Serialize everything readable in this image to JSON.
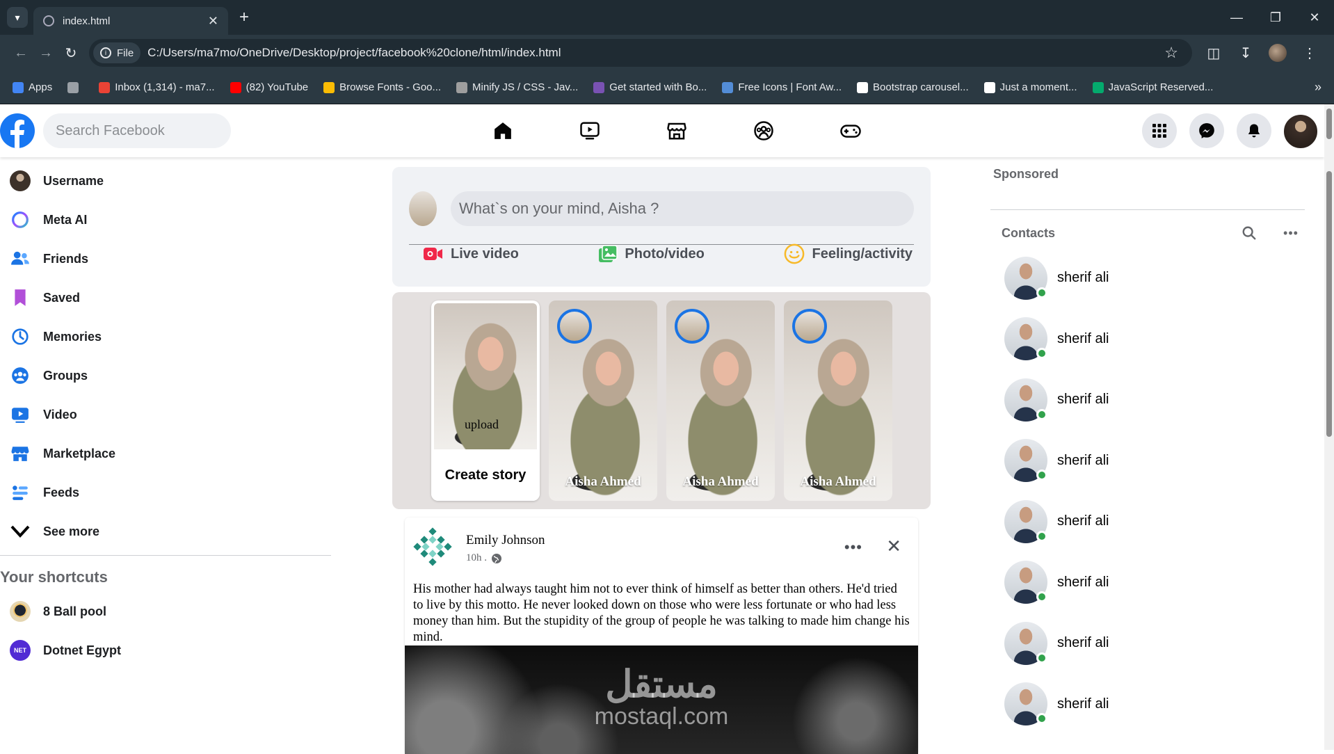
{
  "browser": {
    "tab_title": "index.html",
    "url": "C:/Users/ma7mo/OneDrive/Desktop/project/facebook%20clone/html/index.html",
    "file_chip": "File",
    "bookmarks": [
      {
        "label": "Apps",
        "color": "#4285f4"
      },
      {
        "label": "",
        "color": "#9aa0a6"
      },
      {
        "label": "Inbox (1,314) - ma7...",
        "color": "#ea4335"
      },
      {
        "label": "(82) YouTube",
        "color": "#ff0000"
      },
      {
        "label": "Browse Fonts - Goo...",
        "color": "#fbbc04"
      },
      {
        "label": "Minify JS / CSS - Jav...",
        "color": "#9e9e9e"
      },
      {
        "label": "Get started with Bo...",
        "color": "#7952b3"
      },
      {
        "label": "Free Icons | Font Aw...",
        "color": "#538dd7"
      },
      {
        "label": "Bootstrap carousel...",
        "color": "#ffffff"
      },
      {
        "label": "Just a moment...",
        "color": "#ffffff"
      },
      {
        "label": "JavaScript Reserved...",
        "color": "#04aa6d"
      }
    ]
  },
  "header": {
    "search_placeholder": "Search Facebook"
  },
  "sidebar": {
    "items": [
      {
        "label": "Username",
        "icon": "user-avatar"
      },
      {
        "label": "Meta AI",
        "icon": "meta-ai-icon"
      },
      {
        "label": "Friends",
        "icon": "friends-icon"
      },
      {
        "label": "Saved",
        "icon": "bookmark-icon"
      },
      {
        "label": "Memories",
        "icon": "clock-icon"
      },
      {
        "label": "Groups",
        "icon": "groups-icon"
      },
      {
        "label": "Video",
        "icon": "video-icon"
      },
      {
        "label": "Marketplace",
        "icon": "store-icon"
      },
      {
        "label": "Feeds",
        "icon": "feeds-icon"
      },
      {
        "label": "See more",
        "icon": "chevron-down-icon"
      }
    ],
    "shortcuts_title": "Your shortcuts",
    "shortcuts": [
      {
        "label": "8 Ball pool"
      },
      {
        "label": "Dotnet Egypt",
        "badge": "NET"
      }
    ]
  },
  "composer": {
    "placeholder": "What`s on your mind, Aisha ?",
    "actions": [
      {
        "label": "Live video",
        "color": "#f02849"
      },
      {
        "label": "Photo/video",
        "color": "#45bd62"
      },
      {
        "label": "Feeling/activity",
        "color": "#f7b928"
      }
    ]
  },
  "stories": {
    "create_label": "Create story",
    "upload_label": "upload",
    "items": [
      {
        "name": "Aisha Ahmed"
      },
      {
        "name": "Aisha Ahmed"
      },
      {
        "name": "Aisha Ahmed"
      }
    ]
  },
  "post": {
    "author": "Emily Johnson",
    "time": "10h .",
    "text": "His mother had always taught him not to ever think of himself as better than others. He'd tried to live by this motto. He never looked down on those who were less fortunate or who had less money than him. But the stupidity of the group of people he was talking to made him change his mind.",
    "watermark_ar": "مستقل",
    "watermark_en": "mostaql.com"
  },
  "rightbar": {
    "sponsored": "Sponsored",
    "contacts_title": "Contacts",
    "contacts": [
      {
        "name": "sherif ali",
        "online": true
      },
      {
        "name": "sherif ali",
        "online": true
      },
      {
        "name": "sherif ali",
        "online": true
      },
      {
        "name": "sherif ali",
        "online": true
      },
      {
        "name": "sherif ali",
        "online": true
      },
      {
        "name": "sherif ali",
        "online": true
      },
      {
        "name": "sherif ali",
        "online": true
      },
      {
        "name": "sherif ali",
        "online": true
      }
    ]
  }
}
